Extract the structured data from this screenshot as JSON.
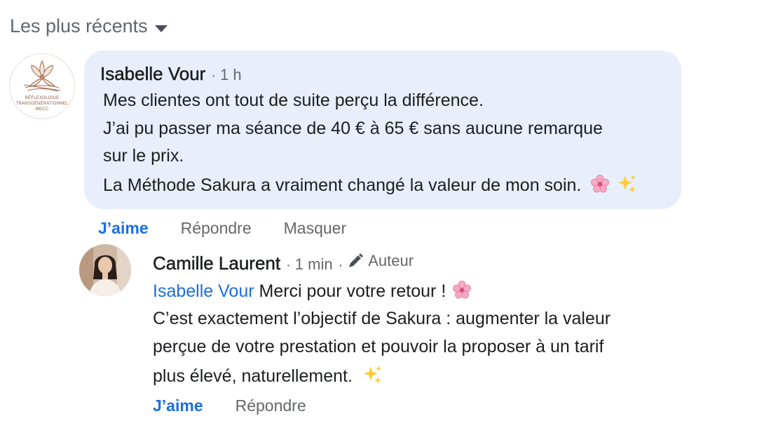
{
  "sort": {
    "label": "Les plus récents",
    "icon": "caret-down-icon"
  },
  "comment": {
    "author": "Isabelle Vour",
    "time": "1 h",
    "avatar_text": [
      "RÉFLEXOLOGIE",
      "TRANSGÉNÉRATIONNEL",
      "MECC"
    ],
    "lines": [
      "Mes clientes ont tout de suite perçu la différence.",
      "J’ai pu passer ma séance de 40 € à 65 € sans aucune remarque",
      "sur le prix.",
      "La Méthode Sakura a vraiment changé la valeur de mon soin."
    ],
    "emojis": [
      "cherry-blossom-icon",
      "sparkles-icon"
    ],
    "actions": {
      "like": "J’aime",
      "reply": "Répondre",
      "hide": "Masquer"
    }
  },
  "reply": {
    "author": "Camille Laurent",
    "time": "1 min",
    "author_badge": "Auteur",
    "badge_icon": "pencil-icon",
    "mention": "Isabelle Vour",
    "first_line_rest": "Merci pour votre retour !",
    "lines": [
      "C’est exactement l’objectif de Sakura : augmenter la valeur",
      "perçue de votre prestation et pouvoir la proposer à un tarif",
      "plus élevé, naturellement."
    ],
    "actions": {
      "like": "J’aime",
      "reply": "Répondre"
    }
  },
  "colors": {
    "bubble": "#e8effa",
    "link": "#1b6fe0",
    "muted": "#65676b"
  }
}
